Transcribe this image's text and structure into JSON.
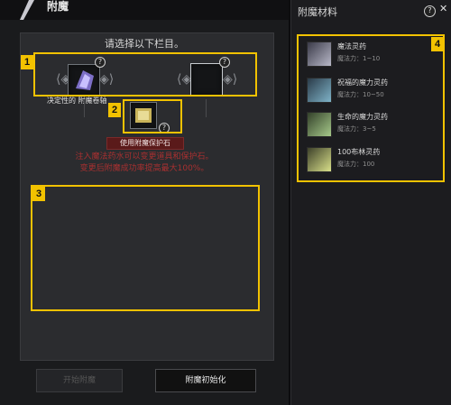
{
  "window": {
    "title": "附魔"
  },
  "main": {
    "instruction": "请选择以下栏目。",
    "item_label": "决定性的 附魔卷轴",
    "protect_label": "使用附魔保护石",
    "warning_line1": "注入魔法药水可以变更道具和保护石。",
    "warning_line2": "变更后附魔成功率提高最大100%。",
    "question_mark": "?"
  },
  "buttons": {
    "left": "开始附魔",
    "right": "附魔初始化"
  },
  "annotations": [
    "1",
    "2",
    "3",
    "4"
  ],
  "panel": {
    "title": "附魔材料",
    "help": "?",
    "close": "✕",
    "materials": [
      {
        "name": "魔法灵药",
        "power": "魔法力：1~10",
        "color": "#b8b8c8"
      },
      {
        "name": "祝福的魔力灵药",
        "power": "魔法力：10~50",
        "color": "#7fb3c8"
      },
      {
        "name": "生命的魔力灵药",
        "power": "魔法力：3~5",
        "color": "#a6c98a"
      },
      {
        "name": "100布林灵药",
        "power": "魔法力：100",
        "color": "#d9e08a"
      }
    ]
  },
  "colors": {
    "highlight": "#f2c200",
    "warning": "#a83030"
  }
}
